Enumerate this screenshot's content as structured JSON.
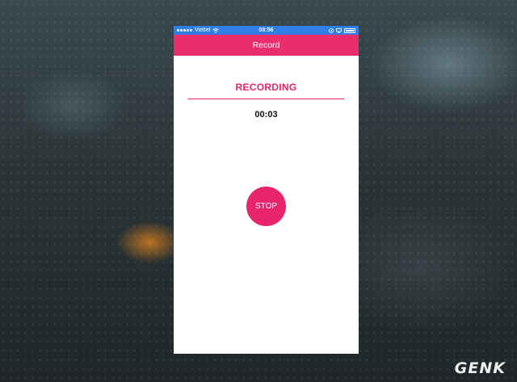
{
  "status_bar": {
    "carrier": "Viettel",
    "time": "08:56",
    "icons": [
      "signal-dots-icon",
      "wifi-icon",
      "location-icon",
      "airplay-icon",
      "battery-icon"
    ]
  },
  "nav_bar": {
    "title": "Record"
  },
  "recorder": {
    "status_label": "RECORDING",
    "elapsed": "00:03",
    "stop_label": "STOP"
  },
  "watermark": {
    "text": "GENK"
  },
  "colors": {
    "accent": "#e8246a",
    "nav": "#ec2d6c",
    "status_bar": "#2f7fe6"
  }
}
